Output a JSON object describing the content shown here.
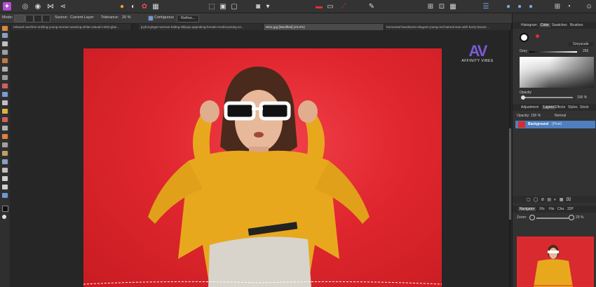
{
  "context_bar": {
    "mode_label": "Mode:",
    "source_label": "Source:",
    "source_value": "Current Layer",
    "tolerance_label": "Tolerance:",
    "tolerance_value": "20 %",
    "contiguous_label": "Contiguous",
    "refine_label": "Refine..."
  },
  "tabs": [
    {
      "label": "relaxed-carefree-smiling-young-woman-wearing-white-casual-t-shirt-glas..."
    },
    {
      "label": "joyful-ginger-woman-hiding-lollipop-appealing-female-model-posing-wi..."
    },
    {
      "label": "0011.jpg [Modified] (23.0%)"
    },
    {
      "label": "horizontal-handsome-elegant-young-red-haired-man-with-fuzzy-beard-..."
    }
  ],
  "watermark": {
    "mark": "AV",
    "text": "AFFINITY VIBES"
  },
  "right_panel": {
    "top_tabs": [
      "Histogram",
      "Color",
      "Swatches",
      "Brushes"
    ],
    "color_mode": "Greyscale",
    "grey_label": "Grey",
    "grey_value": "255",
    "opacity_label": "Opacity",
    "opacity_value": "100 %",
    "mid_tabs": [
      "Adjustment",
      "Layers",
      "Effects",
      "Styles",
      "Stock"
    ],
    "layer_opacity_label": "Opacity:",
    "layer_opacity_value": "100 %",
    "blend_mode": "Normal",
    "layer_name": "Background",
    "layer_type": "(Pixel)",
    "nav_tabs": [
      "Navigator",
      "Xfo",
      "His",
      "Cha",
      "32P"
    ],
    "zoom_label": "Zoom:",
    "zoom_value": "20 %"
  },
  "colors": {
    "accent": "#4f7fc0",
    "photo_bg": "#e0262e",
    "sweater": "#e8a81e"
  }
}
